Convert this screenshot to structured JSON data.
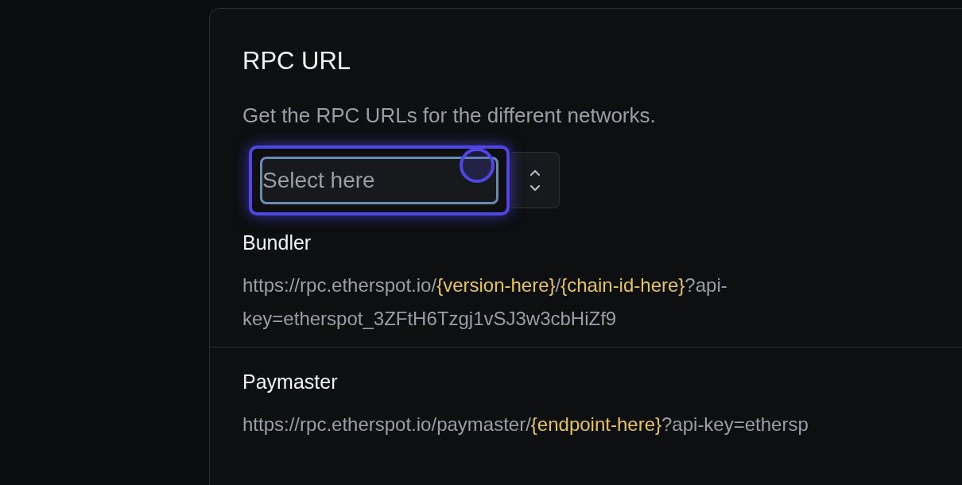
{
  "card": {
    "title": "RPC URL",
    "description": "Get the RPC URLs for the different networks.",
    "select": {
      "placeholder": "Select here",
      "focused": true
    },
    "sections": [
      {
        "heading": "Bundler",
        "url": [
          {
            "kind": "text",
            "text": "https://rpc.etherspot.io/"
          },
          {
            "kind": "variable",
            "text": "{version-here}"
          },
          {
            "kind": "text",
            "text": "/"
          },
          {
            "kind": "variable",
            "text": "{chain-id-here}"
          },
          {
            "kind": "text",
            "text": "?api-key=etherspot_3ZFtH6Tzgj1vSJ3w3cbHiZf9"
          }
        ]
      },
      {
        "heading": "Paymaster",
        "url": [
          {
            "kind": "text",
            "text": "https://rpc.etherspot.io/paymaster/"
          },
          {
            "kind": "variable",
            "text": "{endpoint-here}"
          },
          {
            "kind": "text",
            "text": "?api-key=ethersp"
          }
        ]
      }
    ]
  }
}
